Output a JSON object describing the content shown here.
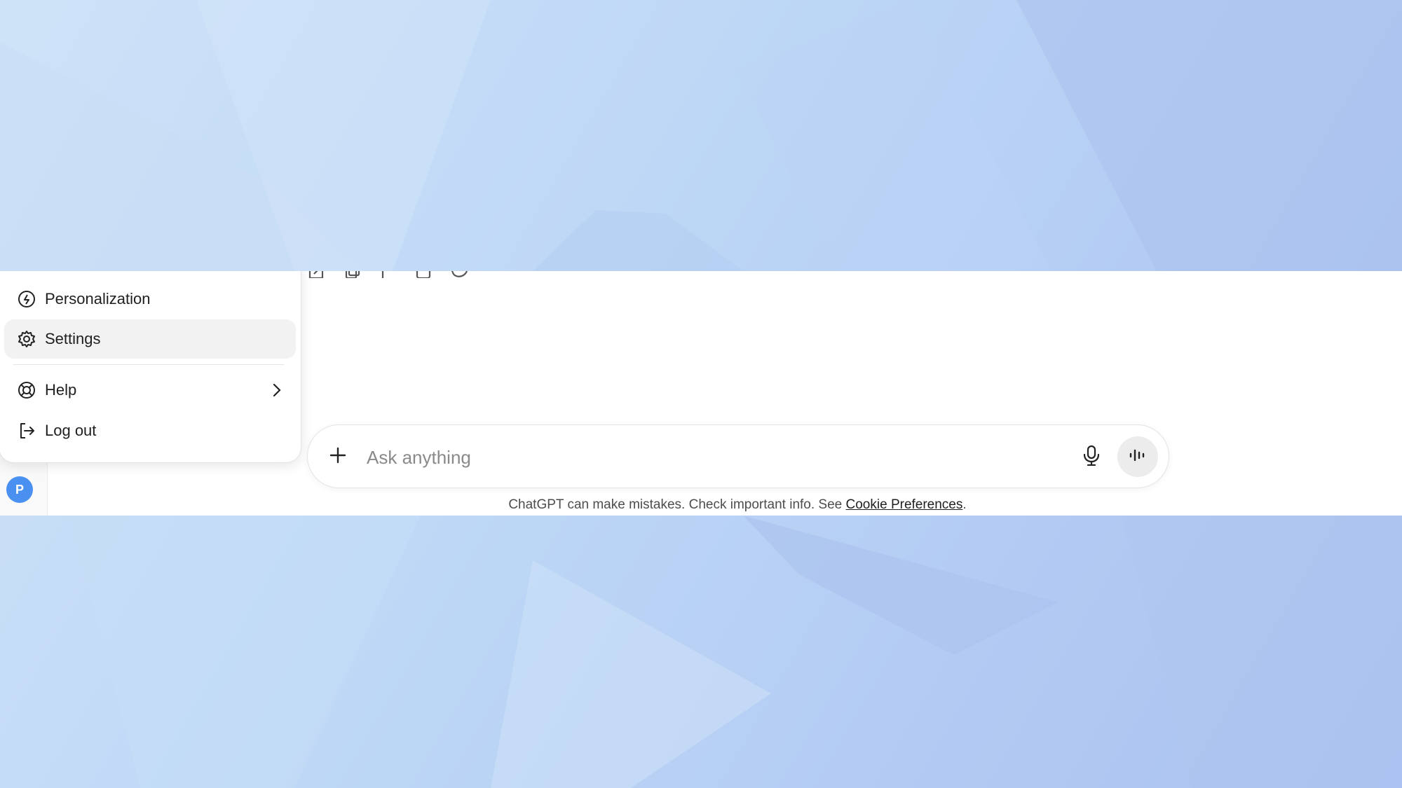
{
  "menu": {
    "items": [
      {
        "label": "Personalization",
        "icon": "personalization-icon"
      },
      {
        "label": "Settings",
        "icon": "gear-icon",
        "active": true
      },
      {
        "label": "Help",
        "icon": "lifebuoy-icon",
        "has_submenu": true
      },
      {
        "label": "Log out",
        "icon": "logout-icon"
      }
    ]
  },
  "user": {
    "avatar_initial": "P",
    "avatar_color": "#4a90f0"
  },
  "composer": {
    "placeholder": "Ask anything"
  },
  "footer": {
    "text": "ChatGPT can make mistakes. Check important info. See ",
    "link": "Cookie Preferences",
    "suffix": "."
  }
}
